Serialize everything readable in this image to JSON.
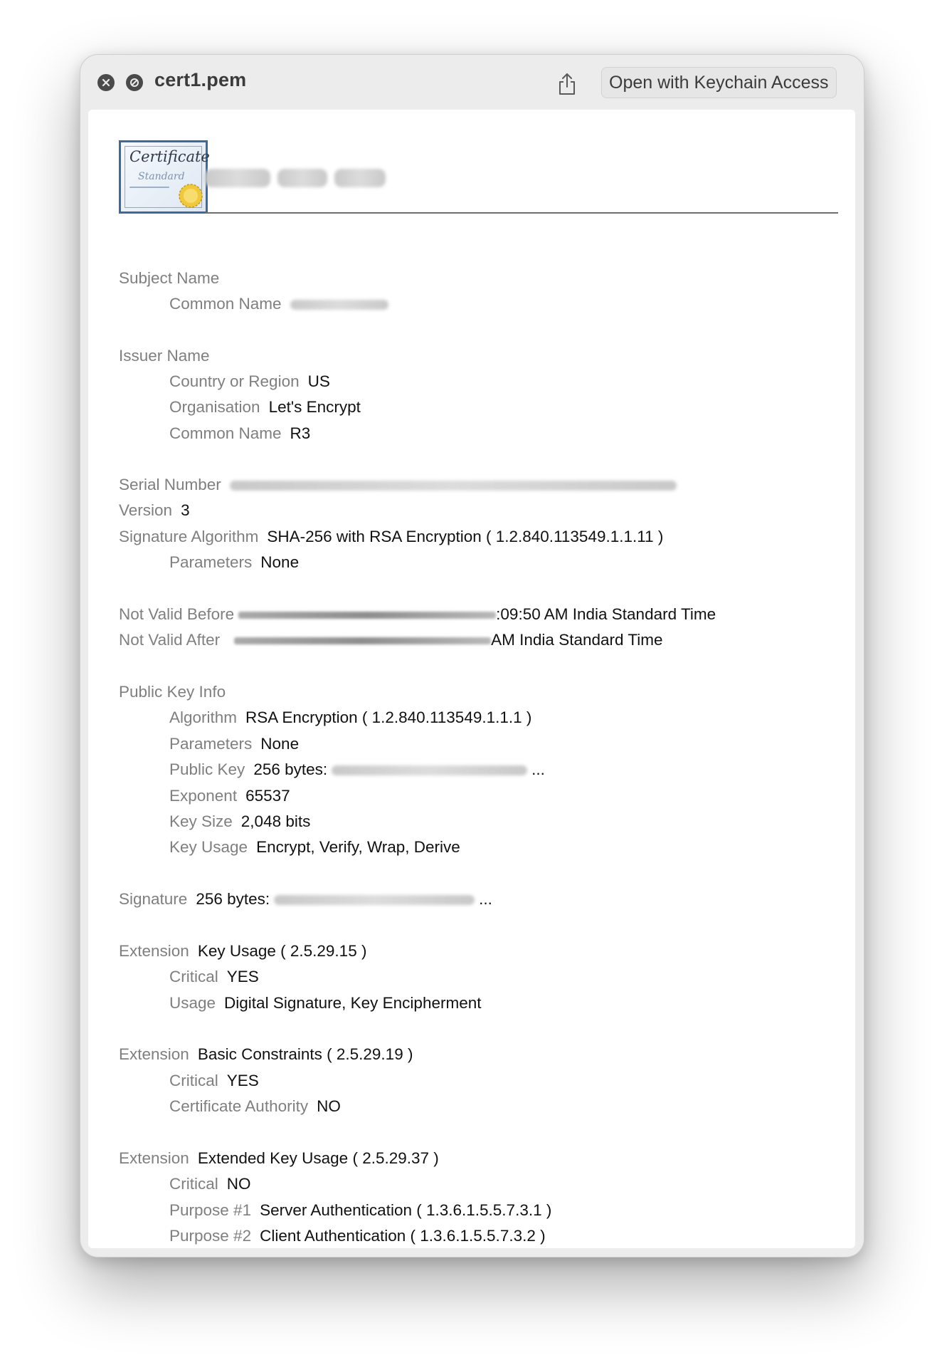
{
  "window": {
    "title": "cert1.pem",
    "open_button_label": "Open with Keychain Access"
  },
  "icons": {
    "close": "close-icon",
    "stop": "stop-icon",
    "share": "share-icon",
    "certificate": "certificate-icon"
  },
  "header": {
    "cert_word": "Certificate",
    "cert_sub": "Standard"
  },
  "fields": {
    "subject_name": "Subject Name",
    "subject_common_name_label": "Common Name",
    "issuer_name": "Issuer Name",
    "issuer_country_label": "Country or Region",
    "issuer_country_value": "US",
    "issuer_org_label": "Organisation",
    "issuer_org_value": "Let's Encrypt",
    "issuer_common_name_label": "Common Name",
    "issuer_common_name_value": "R3",
    "serial_number_label": "Serial Number",
    "version_label": "Version",
    "version_value": "3",
    "sig_alg_label": "Signature Algorithm",
    "sig_alg_value": "SHA-256 with RSA Encryption ( 1.2.840.113549.1.1.11 )",
    "sig_params_label": "Parameters",
    "sig_params_value": "None",
    "not_before_label": "Not Valid Before",
    "not_before_tail": ":09:50 AM India Standard Time",
    "not_after_label": "Not Valid After",
    "not_after_tail": "AM India Standard Time",
    "pki_label": "Public Key Info",
    "pki_alg_label": "Algorithm",
    "pki_alg_value": "RSA Encryption ( 1.2.840.113549.1.1.1 )",
    "pki_params_label": "Parameters",
    "pki_params_value": "None",
    "pki_pubkey_label": "Public Key",
    "pki_pubkey_value": "256 bytes:",
    "pki_pubkey_ellipsis": "...",
    "pki_exponent_label": "Exponent",
    "pki_exponent_value": "65537",
    "pki_keysize_label": "Key Size",
    "pki_keysize_value": "2,048 bits",
    "pki_keyusage_label": "Key Usage",
    "pki_keyusage_value": "Encrypt, Verify, Wrap, Derive",
    "signature_label": "Signature",
    "signature_value": "256 bytes:",
    "signature_ellipsis": "...",
    "ext1_label": "Extension",
    "ext1_value": "Key Usage ( 2.5.29.15 )",
    "ext1_critical_label": "Critical",
    "ext1_critical_value": "YES",
    "ext1_usage_label": "Usage",
    "ext1_usage_value": "Digital Signature, Key Encipherment",
    "ext2_label": "Extension",
    "ext2_value": "Basic Constraints ( 2.5.29.19 )",
    "ext2_critical_label": "Critical",
    "ext2_critical_value": "YES",
    "ext2_ca_label": "Certificate Authority",
    "ext2_ca_value": "NO",
    "ext3_label": "Extension",
    "ext3_value": "Extended Key Usage ( 2.5.29.37 )",
    "ext3_critical_label": "Critical",
    "ext3_critical_value": "NO",
    "ext3_purpose1_label": "Purpose #1",
    "ext3_purpose1_value": "Server Authentication ( 1.3.6.1.5.5.7.3.1 )",
    "ext3_purpose2_label": "Purpose #2",
    "ext3_purpose2_value": "Client Authentication ( 1.3.6.1.5.5.7.3.2 )"
  }
}
